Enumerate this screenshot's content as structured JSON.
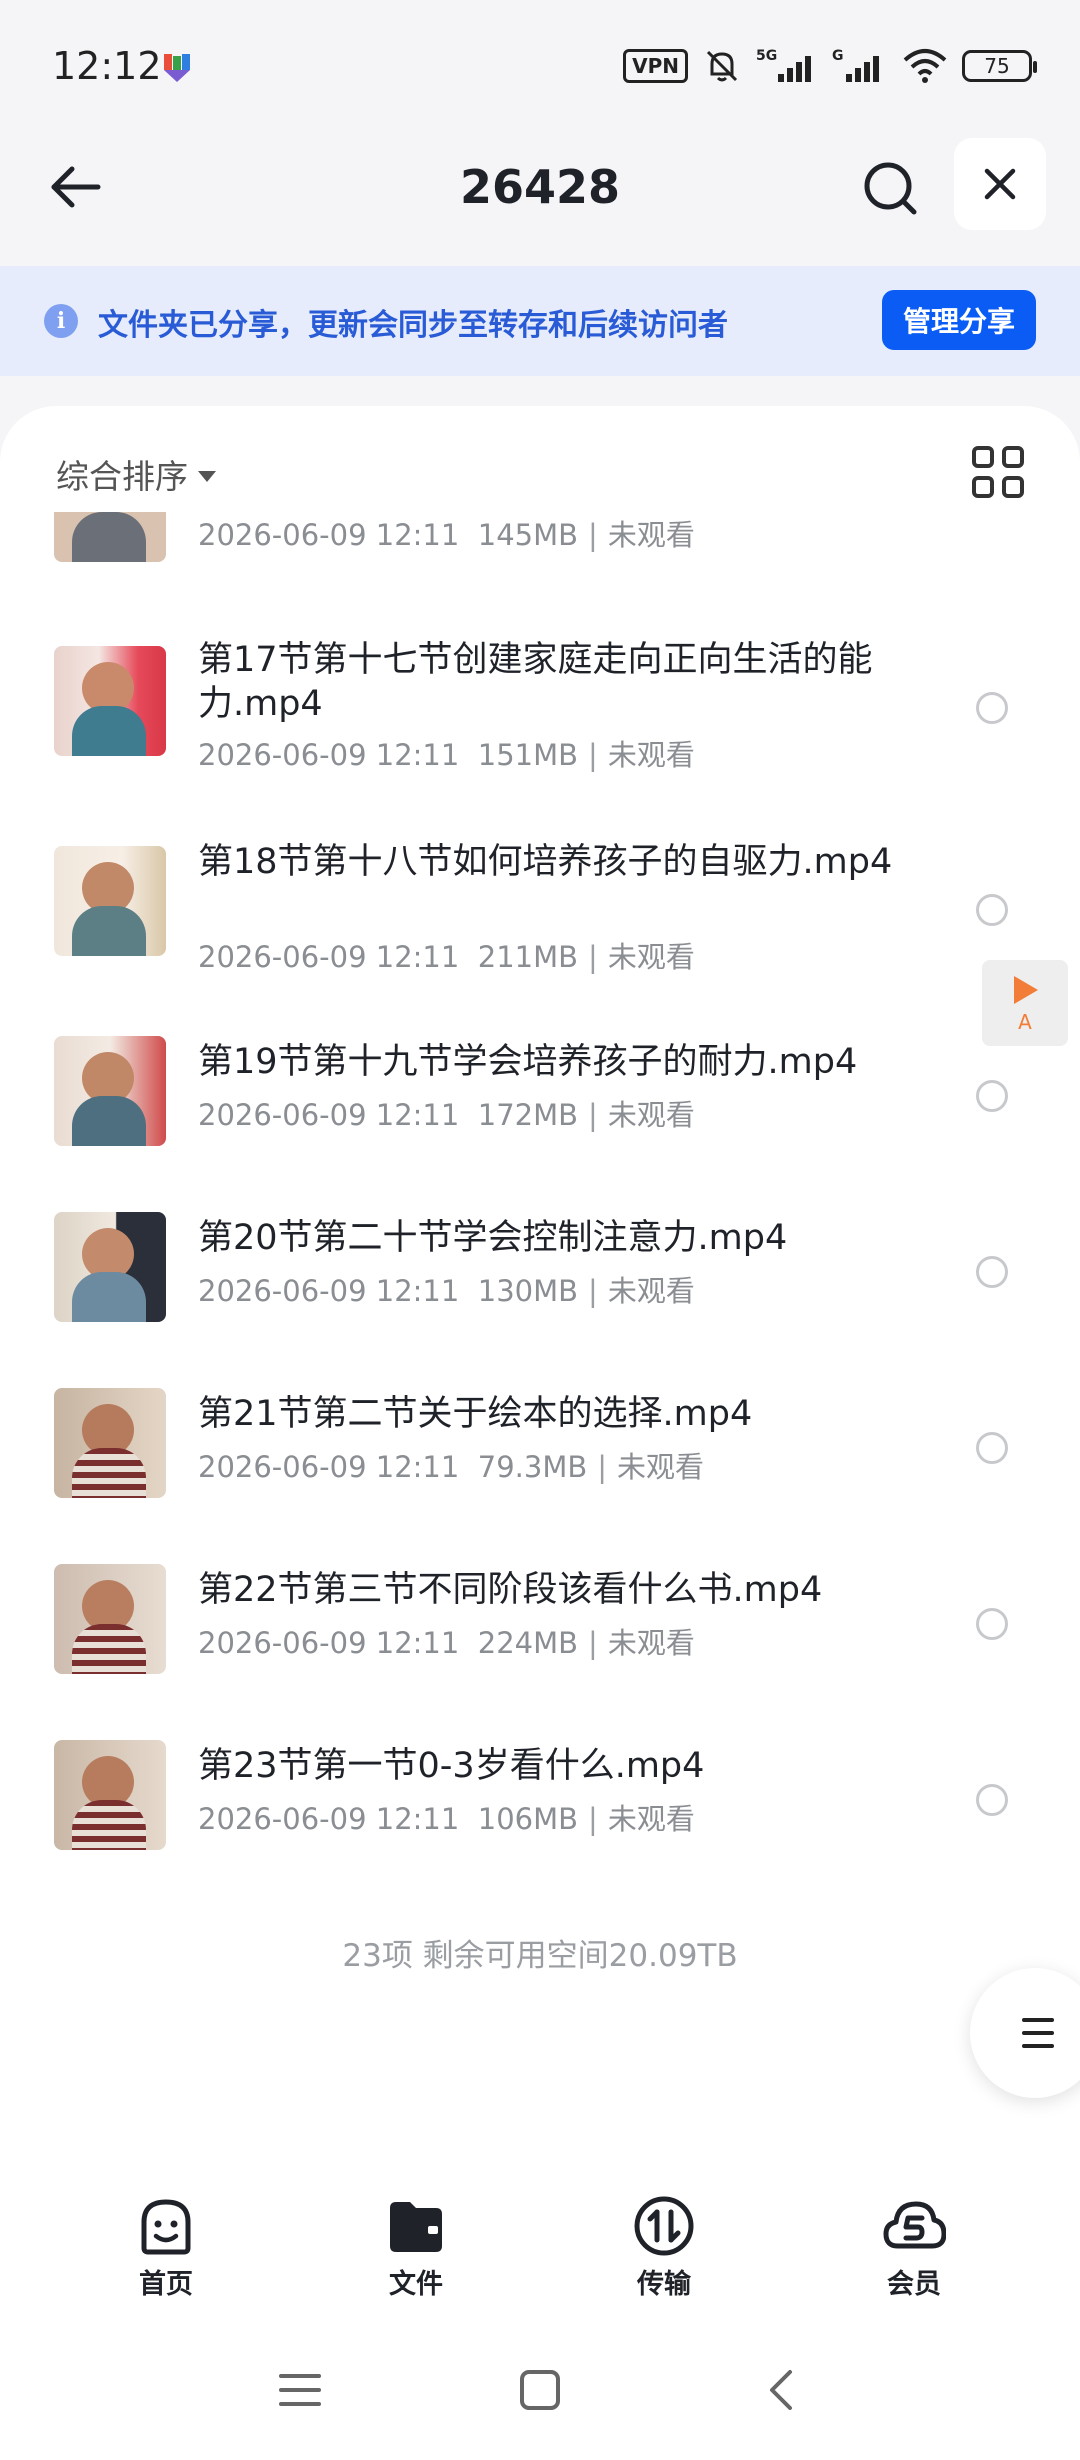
{
  "status_bar": {
    "time": "12:12",
    "vpn": "VPN",
    "network_1": "5G",
    "network_2": "G",
    "battery": "75"
  },
  "header": {
    "title": "26428",
    "back_icon": "arrow-left-icon",
    "search_icon": "search-icon",
    "close_icon": "close-icon"
  },
  "banner": {
    "text": "文件夹已分享，更新会同步至转存和后续访问者",
    "button": "管理分享"
  },
  "sort": {
    "label": "综合排序"
  },
  "files": [
    {
      "name": "",
      "date": "2026-06-09 12:11",
      "size": "145MB",
      "status": "未观看"
    },
    {
      "name": "第17节第十七节创建家庭走向正向生活的能力.mp4",
      "date": "2026-06-09 12:11",
      "size": "151MB",
      "status": "未观看"
    },
    {
      "name": "第18节第十八节如何培养孩子的自驱力.mp4",
      "date": "2026-06-09 12:11",
      "size": "211MB",
      "status": "未观看"
    },
    {
      "name": "第19节第十九节学会培养孩子的耐力.mp4",
      "date": "2026-06-09 12:11",
      "size": "172MB",
      "status": "未观看"
    },
    {
      "name": "第20节第二十节学会控制注意力.mp4",
      "date": "2026-06-09 12:11",
      "size": "130MB",
      "status": "未观看"
    },
    {
      "name": "第21节第二节关于绘本的选择.mp4",
      "date": "2026-06-09 12:11",
      "size": "79.3MB",
      "status": "未观看"
    },
    {
      "name": "第22节第三节不同阶段该看什么书.mp4",
      "date": "2026-06-09 12:11",
      "size": "224MB",
      "status": "未观看"
    },
    {
      "name": "第23节第一节0-3岁看什么.mp4",
      "date": "2026-06-09 12:11",
      "size": "106MB",
      "status": "未观看"
    }
  ],
  "footer": {
    "count": "23项 剩余可用空间20.09TB"
  },
  "float_player": {
    "label": "A"
  },
  "bottom_nav": [
    {
      "label": "首页",
      "icon": "home-smile-icon"
    },
    {
      "label": "文件",
      "icon": "folder-icon"
    },
    {
      "label": "传输",
      "icon": "transfer-icon"
    },
    {
      "label": "会员",
      "icon": "vip-cloud-icon"
    }
  ]
}
